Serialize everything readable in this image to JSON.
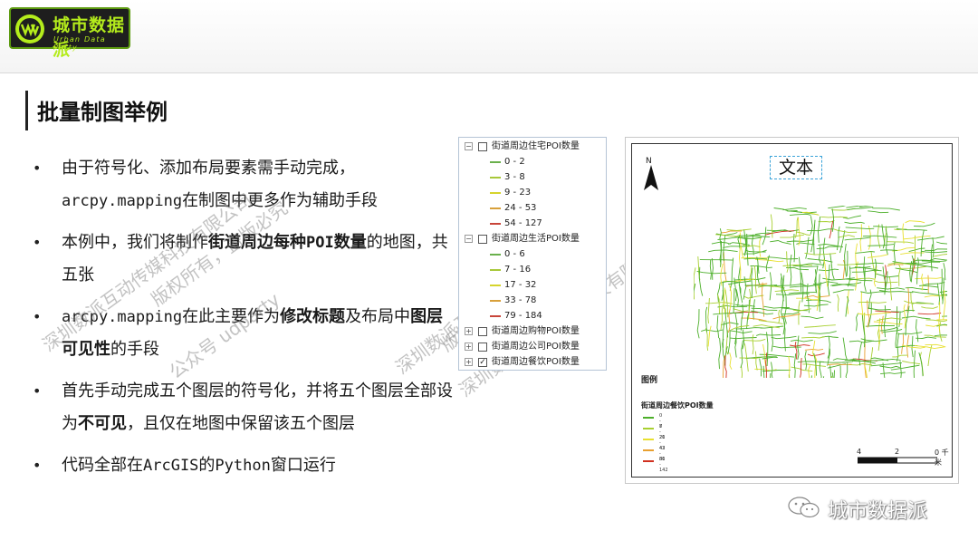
{
  "brand": {
    "name": "城市数据派",
    "subtitle": "Urban Data Party",
    "accent": "#b4ec1c",
    "background": "#1e1e1e"
  },
  "page": {
    "title": "批量制图举例"
  },
  "bullets": [
    [
      {
        "t": "由于符号化、添加布局要素需手动完成，"
      },
      {
        "t": "arcpy.mapping",
        "mono": true
      },
      {
        "t": "在制图中更多作为辅助手段"
      }
    ],
    [
      {
        "t": "本例中，我们将制作"
      },
      {
        "t": "街道周边每种",
        "b": true
      },
      {
        "t": "POI",
        "b": true,
        "mono": true
      },
      {
        "t": "数量",
        "b": true
      },
      {
        "t": "的地图，共五张"
      }
    ],
    [
      {
        "t": "arcpy.mapping",
        "mono": true
      },
      {
        "t": "在此主要作为"
      },
      {
        "t": "修改标题",
        "b": true
      },
      {
        "t": "及布局中"
      },
      {
        "t": "图层可见性",
        "b": true
      },
      {
        "t": "的手段"
      }
    ],
    [
      {
        "t": "首先手动完成五个图层的符号化，并将五个图层全部设为"
      },
      {
        "t": "不可见",
        "b": true
      },
      {
        "t": "，且仅在地图中保留该五个图层"
      }
    ],
    [
      {
        "t": "代码全部在"
      },
      {
        "t": "ArcGIS",
        "mono": true
      },
      {
        "t": "的"
      },
      {
        "t": "Python",
        "mono": true
      },
      {
        "t": "窗口运行"
      }
    ]
  ],
  "watermarks": [
    "深圳数派互动传媒科技有限公司",
    "版权所有，盗版必究",
    "公众号 udparty"
  ],
  "toc": {
    "layers": [
      {
        "name": "街道周边住宅POI数量",
        "expanded": true,
        "checked": false,
        "classes": [
          {
            "label": "0 - 2",
            "color": "#6ab04c"
          },
          {
            "label": "3 - 8",
            "color": "#a8c83a"
          },
          {
            "label": "9 - 23",
            "color": "#d6d42c"
          },
          {
            "label": "24 - 53",
            "color": "#d8a03a"
          },
          {
            "label": "54 - 127",
            "color": "#c8453a"
          }
        ]
      },
      {
        "name": "街道周边生活POI数量",
        "expanded": true,
        "checked": false,
        "classes": [
          {
            "label": "0 - 6",
            "color": "#6ab04c"
          },
          {
            "label": "7 - 16",
            "color": "#a8c83a"
          },
          {
            "label": "17 - 32",
            "color": "#d6d42c"
          },
          {
            "label": "33 - 78",
            "color": "#d8a03a"
          },
          {
            "label": "79 - 184",
            "color": "#c8453a"
          }
        ]
      },
      {
        "name": "街道周边购物POI数量",
        "expanded": false,
        "checked": false,
        "classes": []
      },
      {
        "name": "街道周边公司POI数量",
        "expanded": false,
        "checked": false,
        "classes": []
      },
      {
        "name": "街道周边餐饮POI数量",
        "expanded": false,
        "checked": true,
        "classes": []
      }
    ]
  },
  "map": {
    "title": "文本",
    "north": "N",
    "legend_title": "图例",
    "legend_layer": "街道周边餐饮POI数量",
    "legend_classes": [
      {
        "label": "0 - 7",
        "color": "#4caf2a"
      },
      {
        "label": "8 - 20",
        "color": "#a8d030"
      },
      {
        "label": "21 - 42",
        "color": "#e8e030"
      },
      {
        "label": "43 - 80",
        "color": "#e8a030"
      },
      {
        "label": "81 - 142",
        "color": "#d03020"
      }
    ],
    "scale": {
      "l0": "4",
      "l1": "2",
      "l2": "0 千米"
    }
  },
  "footer": {
    "name": "城市数据派"
  }
}
